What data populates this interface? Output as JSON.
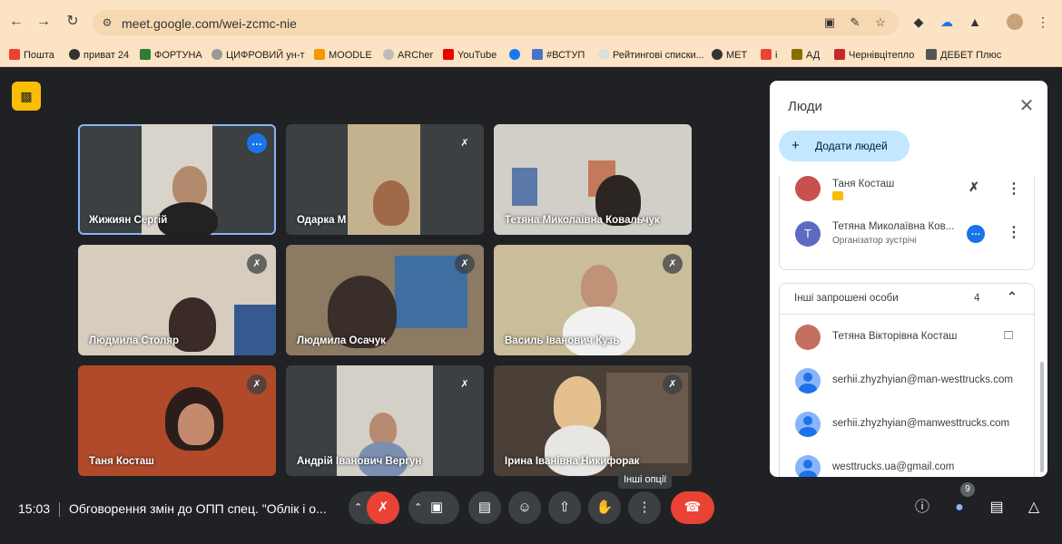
{
  "browser": {
    "url": "meet.google.com/wei-zcmc-nie",
    "bookmarks": [
      "Пошта",
      "приват 24",
      "ФОРТУНА",
      "ЦИФРОВИЙ ун-т",
      "MOODLE",
      "ARCher",
      "YouTube",
      "",
      "#ВСТУП",
      "Рейтингові списки...",
      "MET",
      "і",
      "АД",
      "Чернівцітепло",
      "ДЕБЕТ Плюс"
    ]
  },
  "participants": [
    {
      "name": "Жижиян Сергій"
    },
    {
      "name": "Одарка М"
    },
    {
      "name": "Тетяна Миколаївна Ковальчук"
    },
    {
      "name": "Людмила Столяр"
    },
    {
      "name": "Людмила Осачук"
    },
    {
      "name": "Василь Іванович Кузь"
    },
    {
      "name": "Таня Косташ"
    },
    {
      "name": "Андрій Іванович Вергун"
    },
    {
      "name": "Ірина Іванівна Никифорак"
    }
  ],
  "bottom_bar": {
    "time": "15:03",
    "meeting_title": "Обговорення змін до ОПП спец. \"Облік і о...",
    "tooltip": "Інші опції",
    "people_count": "9"
  },
  "panel": {
    "title": "Люди",
    "add_label": "Додати людей",
    "in_call": [
      {
        "name": "Таня Косташ",
        "sub": ""
      },
      {
        "name": "Тетяна Миколаївна Ков...",
        "sub": "Організатор зустрічі",
        "initial": "T"
      }
    ],
    "invited_header": "Інші запрошені особи",
    "invited_count": "4",
    "invited": [
      {
        "name": "Тетяна Вікторівна Косташ"
      },
      {
        "name": "serhii.zhyzhyian@man-westtrucks.com"
      },
      {
        "name": "serhii.zhyzhyian@manwesttrucks.com"
      },
      {
        "name": "westtrucks.ua@gmail.com"
      }
    ]
  }
}
